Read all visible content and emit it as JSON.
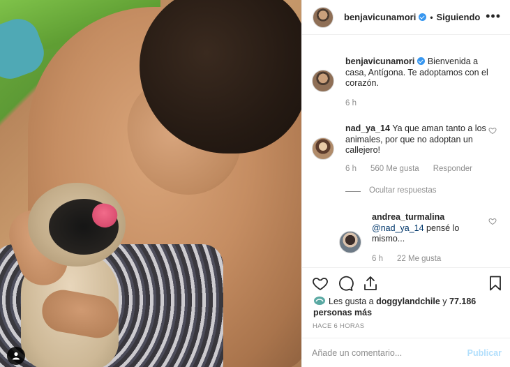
{
  "post": {
    "photo_tag_icon": "user-tag-icon"
  },
  "header": {
    "username": "benjavicunamori",
    "separator": "•",
    "follow_status": "Siguiendo",
    "more_icon": "•••"
  },
  "caption": {
    "username": "benjavicunamori",
    "text": "Bienvenida a casa, Antígona. Te adoptamos con el corazón.",
    "time": "6 h"
  },
  "comments": [
    {
      "username": "nad_ya_14",
      "text": "Ya que aman tanto a los animales, por que no adoptan un callejero!",
      "time": "6 h",
      "likes": "560 Me gusta",
      "reply_label": "Responder",
      "hide_replies": "Ocultar respuestas",
      "replies": [
        {
          "username": "andrea_turmalina",
          "mention": "@nad_ya_14",
          "text": "pensé lo mismo...",
          "time": "6 h",
          "likes": "22 Me gusta"
        }
      ]
    }
  ],
  "likes": {
    "prefix": "Les gusta a",
    "user": "doggylandchile",
    "connector": "y",
    "count": "77.186 personas más"
  },
  "timestamp": "HACE 6 HORAS",
  "composer": {
    "placeholder": "Añade un comentario...",
    "publish_label": "Publicar"
  },
  "colors": {
    "verified": "#3897f0",
    "publish_disabled": "#b2dffc",
    "meta_text": "#8e8e8e"
  }
}
